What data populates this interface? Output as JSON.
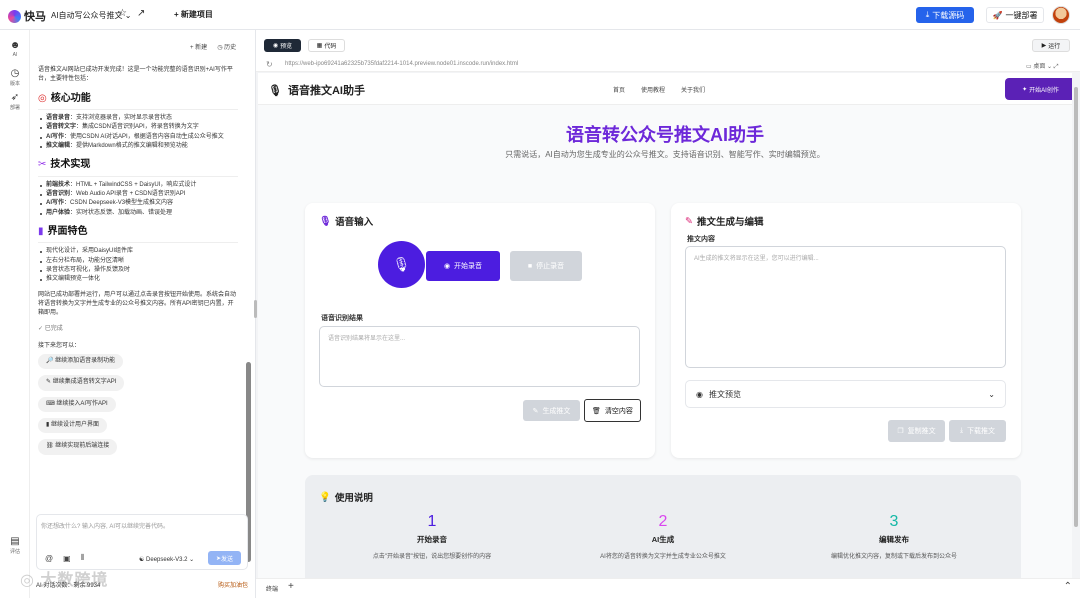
{
  "topbar": {
    "brand": "快马",
    "project": "AI自动写公众号推文",
    "new_project": "新建项目",
    "download": "下载源码",
    "deploy": "一键部署"
  },
  "rail": [
    {
      "label": "AI"
    },
    {
      "label": "版本"
    },
    {
      "label": "部署"
    },
    {
      "label": "评估"
    }
  ],
  "chat": {
    "new": "新建",
    "history": "历史",
    "intro": "语音推文AI网站已成功开发完成！这是一个功能完整的语音识别+AI写作平台，主要特性包括：",
    "s1": {
      "title": "核心功能",
      "items": [
        {
          "k": "语音录音",
          "v": "：支持浏览器录音，实时显示录音状态"
        },
        {
          "k": "语音转文字",
          "v": "：集成CSDN语音识别API，将录音转换为文字"
        },
        {
          "k": "AI写作",
          "v": "：使用CSDN AI对话API，根据语音内容自动生成公众号推文"
        },
        {
          "k": "推文编辑",
          "v": "：提供Markdown格式的推文编辑和预览功能"
        }
      ]
    },
    "s2": {
      "title": "技术实现",
      "items": [
        {
          "k": "前端技术",
          "v": "：HTML + TailwindCSS + DaisyUI，响应式设计"
        },
        {
          "k": "语音识别",
          "v": "：Web Audio API录音 + CSDN语音识别API"
        },
        {
          "k": "AI写作",
          "v": "：CSDN Deepseek-V3模型生成推文内容"
        },
        {
          "k": "用户体验",
          "v": "：实时状态反馈、加载动画、错误处理"
        }
      ]
    },
    "s3": {
      "title": "界面特色",
      "items": [
        "现代化设计，采用DaisyUI组件库",
        "左右分栏布局，功能分区清晰",
        "录音状态可视化，操作反馈及时",
        "推文编辑预览一体化"
      ]
    },
    "summary": "网站已成功部署并运行，用户可以通过点击录音按钮开始使用。系统会自动将语音转换为文字并生成专业的公众号推文内容。所有API密钥已内置，开箱即用。",
    "done": "已完成",
    "next": "接下来您可以：",
    "suggestions": [
      "继续添加语音录制功能",
      "继续集成语音转文字API",
      "继续接入AI写作API",
      "继续设计用户界面",
      "继续实现前后端连接"
    ],
    "input_placeholder": "你还想改什么? 输入内容, AI可以继续完善代码。",
    "model": "Deepseek-V3.2",
    "send": "发送",
    "footer_left": "AI 对话次数：剩余 9934",
    "footer_right": "购买加油包"
  },
  "preview": {
    "tab_preview": "预览",
    "tab_code": "代码",
    "run": "运行",
    "url": "https://web-ipo69241a62325b735fdaf2214-1014.preview.node01.inscode.run/index.html",
    "device": "桌面"
  },
  "site": {
    "brand": "语音推文AI助手",
    "nav": [
      "首页",
      "使用教程",
      "关于我们"
    ],
    "nav_button": "开始AI创作",
    "hero_title": "语音转公众号推文AI助手",
    "hero_sub": "只需说话，AI自动为您生成专业的公众号推文。支持语音识别、智能写作、实时编辑预览。",
    "voice": {
      "title": "语音输入",
      "start": "开始录音",
      "stop": "停止录音",
      "result_label": "语音识别结果",
      "result_ph": "语音识别结果将显示在这里...",
      "generate": "生成推文",
      "clear": "清空内容"
    },
    "edit": {
      "title": "推文生成与编辑",
      "content_label": "推文内容",
      "content_ph": "AI生成的推文将显示在这里，您可以进行编辑...",
      "preview": "推文预览",
      "copy": "复制推文",
      "download": "下载推文"
    },
    "usage": {
      "title": "使用说明",
      "steps": [
        {
          "n": "1",
          "t": "开始录音",
          "d": "点击\"开始录音\"按钮，说出您想要创作的内容",
          "color": "#4c1de0"
        },
        {
          "n": "2",
          "t": "AI生成",
          "d": "AI将您的语音转换为文字并生成专业公众号推文",
          "color": "#d946ef"
        },
        {
          "n": "3",
          "t": "编辑发布",
          "d": "编辑优化推文内容，复制或下载后发布到公众号",
          "color": "#14b8a6"
        }
      ]
    }
  },
  "bottom": {
    "terminal": "终端"
  },
  "watermark": "大数跨境"
}
